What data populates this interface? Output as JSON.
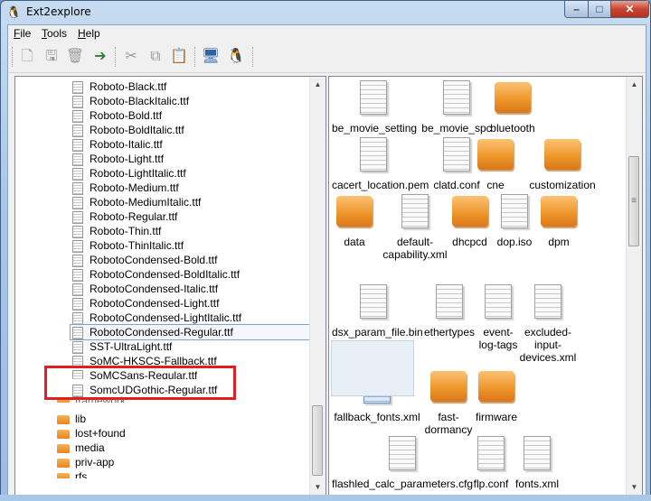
{
  "window": {
    "title": "Ext2explore",
    "minimize_glyph": "–",
    "maximize_glyph": "□",
    "close_glyph": "✕"
  },
  "menu": [
    {
      "label": "File",
      "mnemonic": "F",
      "rest": "ile"
    },
    {
      "label": "Tools",
      "mnemonic": "T",
      "rest": "ools"
    },
    {
      "label": "Help",
      "mnemonic": "H",
      "rest": "elp"
    }
  ],
  "toolbar": {
    "icons": [
      "new-file-icon",
      "disk-icon",
      "save-icon",
      "export-icon",
      "cut-icon",
      "copy-icon",
      "paste-icon",
      "drives-icon",
      "linux-icon"
    ],
    "glyphs": [
      "🗋",
      "🖫",
      "🗑",
      "➔",
      "✂",
      "⧉",
      "📋",
      "🖥",
      "🐧"
    ]
  },
  "tree": {
    "files": [
      "Roboto-Black.ttf",
      "Roboto-BlackItalic.ttf",
      "Roboto-Bold.ttf",
      "Roboto-BoldItalic.ttf",
      "Roboto-Italic.ttf",
      "Roboto-Light.ttf",
      "Roboto-LightItalic.ttf",
      "Roboto-Medium.ttf",
      "Roboto-MediumItalic.ttf",
      "Roboto-Regular.ttf",
      "Roboto-Thin.ttf",
      "Roboto-ThinItalic.ttf",
      "RobotoCondensed-Bold.ttf",
      "RobotoCondensed-BoldItalic.ttf",
      "RobotoCondensed-Italic.ttf",
      "RobotoCondensed-Light.ttf",
      "RobotoCondensed-LightItalic.ttf",
      "RobotoCondensed-Regular.ttf",
      "SST-UltraLight.ttf",
      "SoMC-HKSCS-Fallback.ttf",
      "SoMCSans-Regular.ttf",
      "SomcUDGothic-Regular.ttf"
    ],
    "folders": [
      "framework",
      "lib",
      "lost+found",
      "media",
      "priv-app",
      "rfs"
    ],
    "selected": "RobotoCondensed-Regular.ttf"
  },
  "files_view": {
    "items": [
      {
        "label": "be_movie_setting",
        "kind": "file"
      },
      {
        "label": "be_movie_spc",
        "kind": "file"
      },
      {
        "label": "bluetooth",
        "kind": "folder"
      },
      {
        "label": "cacert_location.pem",
        "kind": "file"
      },
      {
        "label": "clatd.conf",
        "kind": "file"
      },
      {
        "label": "cne",
        "kind": "folder"
      },
      {
        "label": "customization",
        "kind": "folder"
      },
      {
        "label": "data",
        "kind": "folder"
      },
      {
        "label": "default-capability.xml",
        "kind": "file"
      },
      {
        "label": "dhcpcd",
        "kind": "folder"
      },
      {
        "label": "dop.iso",
        "kind": "file"
      },
      {
        "label": "dpm",
        "kind": "folder"
      },
      {
        "label": "dsx_param_file.bin",
        "kind": "file"
      },
      {
        "label": "ethertypes",
        "kind": "file"
      },
      {
        "label": "event-log-tags",
        "kind": "file"
      },
      {
        "label": "excluded-input-devices.xml",
        "kind": "file"
      },
      {
        "label": "fallback_fonts.xml",
        "kind": "file-selected"
      },
      {
        "label": "fast-dormancy",
        "kind": "folder"
      },
      {
        "label": "firmware",
        "kind": "folder"
      },
      {
        "label": "flashled_calc_parameters.cfg",
        "kind": "file"
      },
      {
        "label": "flp.conf",
        "kind": "file"
      },
      {
        "label": "fonts.xml",
        "kind": "file"
      }
    ]
  },
  "scrollbar": {
    "up_glyph": "▲",
    "down_glyph": "▼",
    "grip_glyph": "≡"
  }
}
